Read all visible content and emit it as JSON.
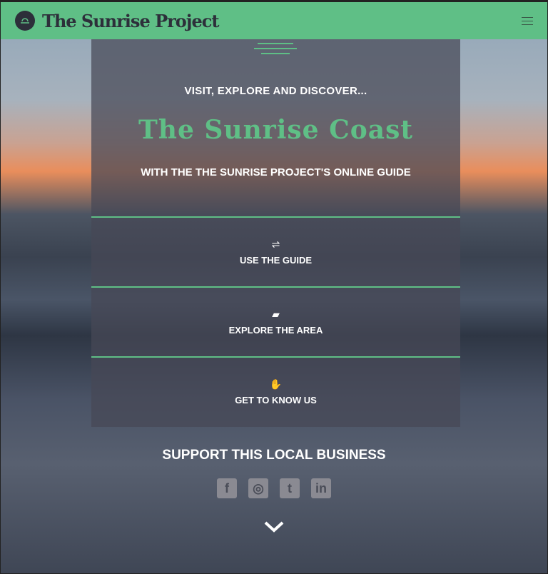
{
  "header": {
    "brand": "The Sunrise Project"
  },
  "hero": {
    "kicker": "VISIT, EXPLORE AND DISCOVER...",
    "title": "The Sunrise Coast",
    "subtitle": "WITH THE THE SUNRISE PROJECT'S ONLINE GUIDE"
  },
  "menu": [
    {
      "label": "USE THE GUIDE",
      "icon": "signpost-icon"
    },
    {
      "label": "EXPLORE THE AREA",
      "icon": "map-icon"
    },
    {
      "label": "GET TO KNOW US",
      "icon": "handshake-icon"
    }
  ],
  "support": {
    "title": "SUPPORT THIS LOCAL BUSINESS",
    "social": [
      "f",
      "◎",
      "t",
      "in"
    ]
  },
  "colors": {
    "accent": "#5fbf86",
    "dark": "#2d2f3a"
  }
}
